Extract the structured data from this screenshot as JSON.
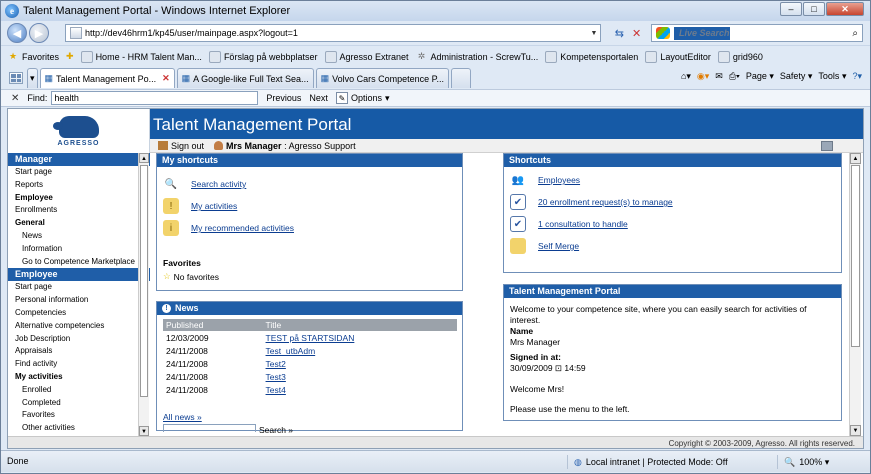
{
  "window": {
    "title": "Talent Management Portal - Windows Internet Explorer"
  },
  "address": {
    "url": "http://dev46hrm1/kp45/user/mainpage.aspx?logout=1"
  },
  "search": {
    "placeholder": "Live Search"
  },
  "favbar": {
    "favorites_label": "Favorites",
    "items": [
      "Home - HRM Talent Man...",
      "Förslag på webbplatser",
      "Agresso Extranet",
      "Administration - ScrewTu...",
      "Kompetensportalen",
      "LayoutEditor",
      "grid960"
    ]
  },
  "tabs": [
    "Talent Management Po...",
    "A Google-like Full Text Sea...",
    "Volvo Cars Competence P..."
  ],
  "tools": {
    "page": "Page",
    "safety": "Safety",
    "tools": "Tools"
  },
  "find": {
    "label": "Find:",
    "value": "health",
    "previous": "Previous",
    "next": "Next",
    "options": "Options"
  },
  "portal": {
    "logo_text": "AGRESSO",
    "title": "Talent Management Portal",
    "sign_out": "Sign out",
    "user": "Mrs Manager",
    "company": ": Agresso Support",
    "footer": "Copyright © 2003-2009, Agresso. All rights reserved."
  },
  "sidebar": {
    "manager_header": "Manager",
    "manager_items": [
      {
        "label": "Start page",
        "style": ""
      },
      {
        "label": "Reports",
        "style": ""
      },
      {
        "label": "Employee",
        "style": "b"
      },
      {
        "label": "Enrollments",
        "style": ""
      },
      {
        "label": "General",
        "style": "b"
      },
      {
        "label": "News",
        "style": "sub"
      },
      {
        "label": "Information",
        "style": "sub"
      },
      {
        "label": "Go to Competence Marketplace",
        "style": "sub"
      }
    ],
    "employee_header": "Employee",
    "employee_items": [
      {
        "label": "Start page",
        "style": ""
      },
      {
        "label": "Personal information",
        "style": ""
      },
      {
        "label": "Competencies",
        "style": ""
      },
      {
        "label": "Alternative competencies",
        "style": ""
      },
      {
        "label": "Job Description",
        "style": ""
      },
      {
        "label": "Appraisals",
        "style": ""
      },
      {
        "label": "Find activity",
        "style": ""
      },
      {
        "label": "My activities",
        "style": "b"
      },
      {
        "label": "Enrolled",
        "style": "sub"
      },
      {
        "label": "Completed",
        "style": "sub"
      },
      {
        "label": "Favorites",
        "style": "sub"
      },
      {
        "label": "Other activities",
        "style": "sub"
      }
    ]
  },
  "my_shortcuts": {
    "title": "My shortcuts",
    "links": [
      "Search activity",
      "My activities",
      "My recommended activities"
    ],
    "favorites_label": "Favorites",
    "no_favorites": "No favorites"
  },
  "news": {
    "title": "News",
    "columns": [
      "Published",
      "Title"
    ],
    "rows": [
      [
        "12/03/2009",
        "TEST på STARTSIDAN"
      ],
      [
        "24/11/2008",
        "Test_utbAdm"
      ],
      [
        "24/11/2008",
        "Test2"
      ],
      [
        "24/11/2008",
        "Test3"
      ],
      [
        "24/11/2008",
        "Test4"
      ]
    ],
    "all_news": "All news »",
    "search": "Search »"
  },
  "shortcuts": {
    "title": "Shortcuts",
    "links": [
      "Employees",
      "20 enrollment request(s) to manage",
      "1 consultation to handle",
      "Self Merge"
    ]
  },
  "welcome": {
    "title": "Talent Management Portal",
    "intro": "Welcome to your competence site, where you can easily search for activities of interest.",
    "name_label": "Name",
    "name": "Mrs Manager",
    "signed_in_label": "Signed in at:",
    "signed_in": "30/09/2009 ⊡ 14:59",
    "greeting": "Welcome Mrs!",
    "instruction": "Please use the menu to the left."
  },
  "status": {
    "done": "Done",
    "zone": "Local intranet | Protected Mode: Off",
    "zoom": "100%"
  }
}
